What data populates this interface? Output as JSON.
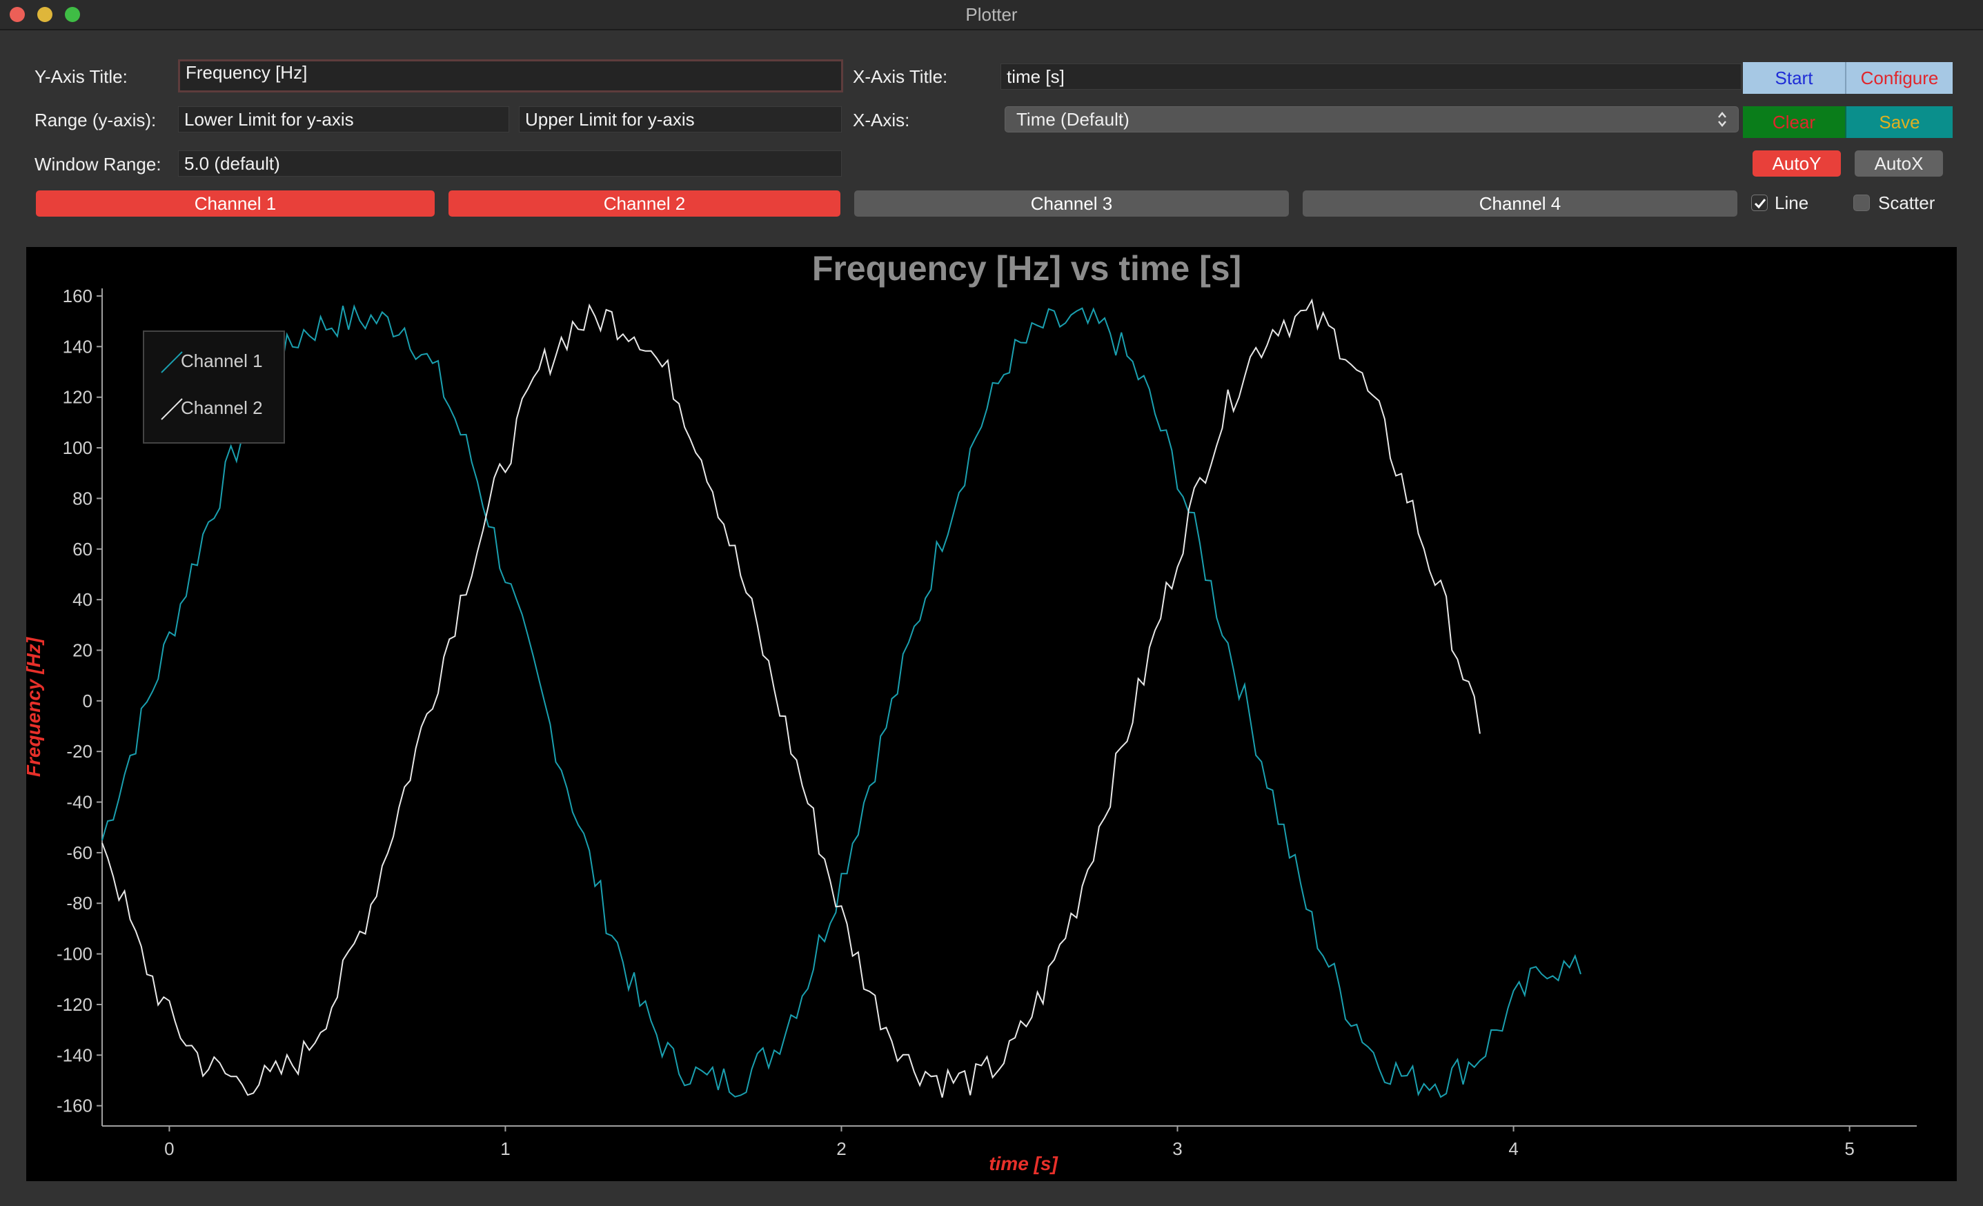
{
  "window": {
    "title": "Plotter"
  },
  "controls": {
    "y_axis_title_label": "Y-Axis Title:",
    "y_axis_title_value": "Frequency [Hz]",
    "range_label": "Range (y-axis):",
    "lower_limit_placeholder": "Lower Limit for y-axis",
    "upper_limit_placeholder": "Upper Limit for y-axis",
    "window_range_label": "Window Range:",
    "window_range_placeholder": "5.0 (default)",
    "x_axis_title_label": "X-Axis Title:",
    "x_axis_title_value": "time [s]",
    "x_axis_label": "X-Axis:",
    "x_axis_selected": "Time (Default)"
  },
  "buttons": {
    "start": "Start",
    "configure": "Configure",
    "clear": "Clear",
    "save": "Save",
    "autoy": "AutoY",
    "autox": "AutoX"
  },
  "channels": [
    {
      "label": "Channel 1",
      "active": true
    },
    {
      "label": "Channel 2",
      "active": true
    },
    {
      "label": "Channel 3",
      "active": false
    },
    {
      "label": "Channel 4",
      "active": false
    }
  ],
  "options": {
    "line_label": "Line",
    "line_checked": true,
    "scatter_label": "Scatter",
    "scatter_checked": false
  },
  "colors": {
    "start_bg": "#a6c8e4",
    "start_fg": "#1f2dd6",
    "configure_bg": "#a6c8e4",
    "configure_fg": "#e0262c",
    "clear_bg": "#0a7d1a",
    "clear_fg": "#e0262c",
    "save_bg": "#0a8f8c",
    "save_fg": "#e0b020",
    "autoy_bg": "#e8403a",
    "autox_bg": "#626262",
    "channel_active": "#e8403a",
    "channel_inactive": "#5a5a5a",
    "channel1_line": "#1aa0b0",
    "channel2_line": "#e8e8e8",
    "axis_title_color": "#e8302a"
  },
  "chart_data": {
    "type": "line",
    "title": "Frequency [Hz] vs time [s]",
    "xlabel": "time [s]",
    "ylabel": "Frequency [Hz]",
    "xlim": [
      -0.2,
      5.2
    ],
    "ylim": [
      -168,
      163
    ],
    "x_ticks": [
      0,
      1,
      2,
      3,
      4,
      5
    ],
    "y_ticks": [
      160,
      140,
      120,
      100,
      80,
      60,
      40,
      20,
      0,
      -20,
      -40,
      -60,
      -80,
      -100,
      -120,
      -140,
      -160
    ],
    "legend_position": "top-left",
    "grid": false,
    "x": [
      -0.2,
      -0.1,
      0.0,
      0.1,
      0.2,
      0.3,
      0.4,
      0.5,
      0.6,
      0.7,
      0.8,
      0.9,
      1.0,
      1.1,
      1.2,
      1.3,
      1.4,
      1.5,
      1.6,
      1.7,
      1.8,
      1.9,
      2.0,
      2.1,
      2.2,
      2.3,
      2.4,
      2.5,
      2.6,
      2.7,
      2.8,
      2.9,
      3.0,
      3.1,
      3.2,
      3.3,
      3.4,
      3.5,
      3.6,
      3.7,
      3.8,
      3.9,
      4.0,
      4.1,
      4.2,
      4.3,
      4.4,
      4.5,
      4.6,
      4.7,
      4.8,
      4.9,
      5.0
    ],
    "series": [
      {
        "name": "Channel 1",
        "values": [
          -55,
          -15,
          25,
          65,
          100,
          130,
          146,
          150,
          151,
          148,
          128,
          95,
          50,
          5,
          -40,
          -85,
          -120,
          -143,
          -150,
          -150,
          -138,
          -110,
          -70,
          -25,
          20,
          65,
          105,
          135,
          148,
          150,
          146,
          125,
          90,
          45,
          0,
          -45,
          -88,
          -120,
          -143,
          -150,
          -150,
          -140,
          -120,
          -104,
          -108
        ]
      },
      {
        "name": "Channel 2",
        "values": [
          -53,
          -95,
          -125,
          -143,
          -150,
          -150,
          -140,
          -115,
          -80,
          -35,
          10,
          55,
          95,
          130,
          148,
          152,
          145,
          125,
          92,
          50,
          5,
          -40,
          -85,
          -120,
          -143,
          -150,
          -150,
          -140,
          -115,
          -80,
          -35,
          10,
          58,
          100,
          132,
          150,
          152,
          140,
          112,
          75,
          35,
          -13
        ]
      }
    ]
  }
}
